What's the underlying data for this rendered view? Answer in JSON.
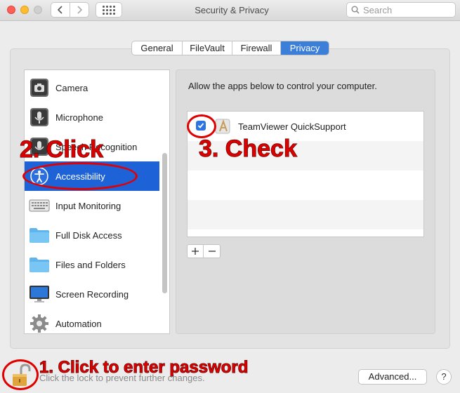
{
  "window": {
    "title": "Security & Privacy",
    "search_placeholder": "Search"
  },
  "tabs": [
    {
      "label": "General",
      "active": false
    },
    {
      "label": "FileVault",
      "active": false
    },
    {
      "label": "Firewall",
      "active": false
    },
    {
      "label": "Privacy",
      "active": true
    }
  ],
  "sidebar": {
    "items": [
      {
        "label": "Camera",
        "icon": "camera-icon"
      },
      {
        "label": "Microphone",
        "icon": "microphone-icon"
      },
      {
        "label": "Speech Recognition",
        "icon": "speech-icon"
      },
      {
        "label": "Accessibility",
        "icon": "accessibility-icon",
        "selected": true
      },
      {
        "label": "Input Monitoring",
        "icon": "keyboard-icon"
      },
      {
        "label": "Full Disk Access",
        "icon": "folder-icon"
      },
      {
        "label": "Files and Folders",
        "icon": "folder-icon"
      },
      {
        "label": "Screen Recording",
        "icon": "display-icon"
      },
      {
        "label": "Automation",
        "icon": "gear-icon"
      }
    ]
  },
  "main": {
    "instruction": "Allow the apps below to control your computer.",
    "apps": [
      {
        "name": "TeamViewer QuickSupport",
        "checked": true
      }
    ]
  },
  "bottom": {
    "lock_text": "Click the lock to prevent further changes.",
    "advanced_label": "Advanced...",
    "help_label": "?"
  },
  "annotations": {
    "step1": "1. Click to enter password",
    "step2": "2. Click",
    "step3": "3. Check"
  },
  "colors": {
    "accent": "#1d62d6",
    "annotation": "#d90000"
  }
}
